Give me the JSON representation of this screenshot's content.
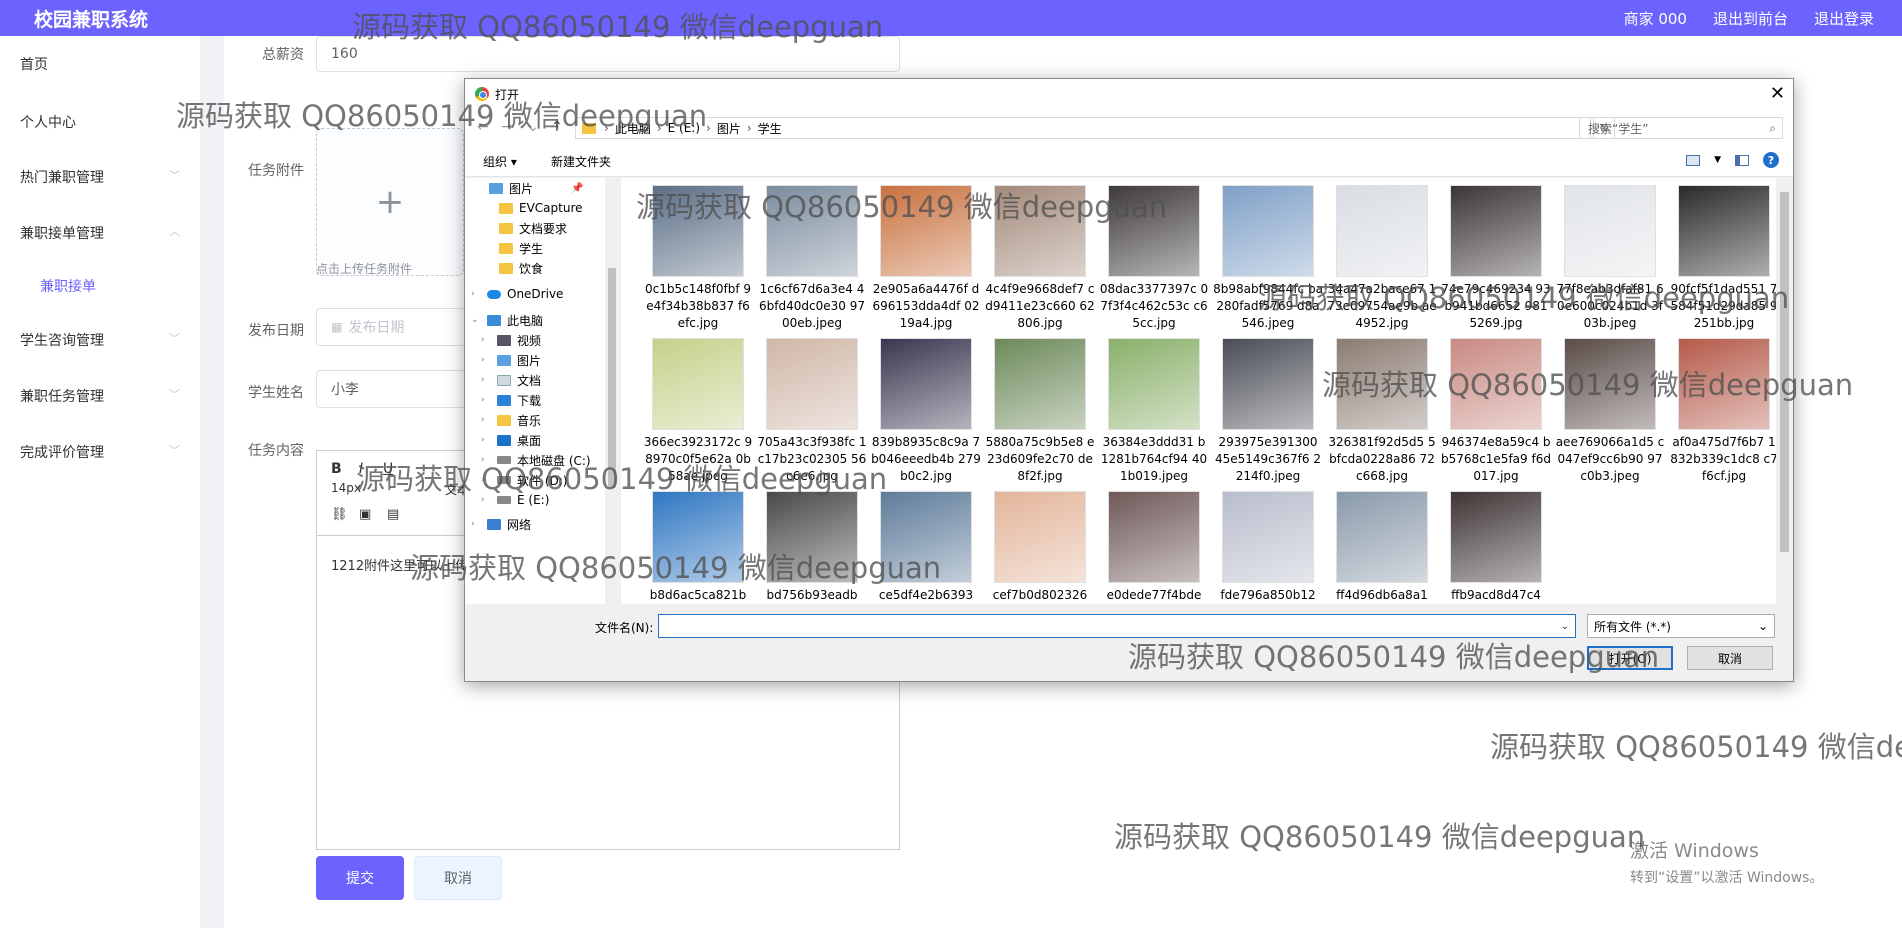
{
  "topbar": {
    "brand": "校园兼职系统",
    "merchant": "商家 000",
    "exit_front": "退出到前台",
    "logout": "退出登录"
  },
  "sidebar": {
    "items": [
      {
        "label": "首页"
      },
      {
        "label": "个人中心"
      },
      {
        "label": "热门兼职管理"
      },
      {
        "label": "兼职接单管理"
      },
      {
        "label": "兼职接单"
      },
      {
        "label": "学生咨询管理"
      },
      {
        "label": "兼职任务管理"
      },
      {
        "label": "完成评价管理"
      }
    ]
  },
  "form": {
    "salary_label": "总薪资",
    "salary_value": "160",
    "attachment_label": "任务附件",
    "upload_plus": "+",
    "upload_hint": "点击上传任务附件",
    "date_label": "发布日期",
    "date_placeholder": "发布日期",
    "student_label": "学生姓名",
    "student_value": "小李",
    "content_label": "任务内容",
    "editor_bold": "B",
    "editor_italic": "I",
    "editor_underline": "U",
    "editor_fontsize": "14px",
    "editor_text_type": "文本",
    "editor_content": "1212附件这里可以上传",
    "submit": "提交",
    "cancel": "取消"
  },
  "windows_activation": {
    "line1": "激活 Windows",
    "line2": "转到“设置”以激活 Windows。"
  },
  "dialog": {
    "title": "打开",
    "close_glyph": "✕",
    "address": [
      "此电脑",
      "E (E:)",
      "图片",
      "学生"
    ],
    "search_placeholder": "搜索“学生”",
    "organize": "组织 ▾",
    "new_folder": "新建文件夹",
    "nav_items": [
      {
        "label": "图片",
        "icon": "picture-folder-icon"
      },
      {
        "label": "EVCapture",
        "icon": "folder-icon"
      },
      {
        "label": "文档要求",
        "icon": "folder-icon"
      },
      {
        "label": "学生",
        "icon": "folder-icon"
      },
      {
        "label": "饮食",
        "icon": "folder-icon"
      },
      {
        "label": "OneDrive",
        "icon": "onedrive-icon"
      },
      {
        "label": "此电脑",
        "icon": "computer-icon"
      },
      {
        "label": "视频",
        "icon": "video-folder-icon"
      },
      {
        "label": "图片",
        "icon": "picture-folder-icon"
      },
      {
        "label": "文档",
        "icon": "document-folder-icon"
      },
      {
        "label": "下载",
        "icon": "download-folder-icon"
      },
      {
        "label": "音乐",
        "icon": "music-folder-icon"
      },
      {
        "label": "桌面",
        "icon": "desktop-folder-icon"
      },
      {
        "label": "本地磁盘 (C:)",
        "icon": "drive-icon"
      },
      {
        "label": "软件 (D:)",
        "icon": "drive-icon"
      },
      {
        "label": "E (E:)",
        "icon": "drive-icon"
      },
      {
        "label": "网络",
        "icon": "network-icon"
      }
    ],
    "files": [
      {
        "name": "0c1b5c148f0fbf 9e4f34b38b837 f6efc.jpg",
        "color": "#5b6f86"
      },
      {
        "name": "1c6cf67d6a3e4 46bfd40dc0e30 9700eb.jpeg",
        "color": "#7b8c9e"
      },
      {
        "name": "2e905a6a4476f d696153dda4df 0219a4.jpg",
        "color": "#c9713e"
      },
      {
        "name": "4c4f9e9668def7 cd9411e23c660 62806.jpg",
        "color": "#a38a7a"
      },
      {
        "name": "08dac3377397c 07f3f4c462c53c c65cc.jpg",
        "color": "#3f3a3a"
      },
      {
        "name": "8b98abf9844fc ba280fadf5769 d8a546.jpeg",
        "color": "#7fa0c7"
      },
      {
        "name": "34a47a2bace67 173e09754ae9b ae4952.jpg",
        "color": "#d9dde3"
      },
      {
        "name": "74e79c469234 93b941bd6652 9815269.jpg",
        "color": "#3c3535"
      },
      {
        "name": "77f8eab3dfaf81 60e600c024b1d 3f03b.jpeg",
        "color": "#e1e4e8"
      },
      {
        "name": "90fcf5f1dad551 7584f51d29da85 9251bb.jpg",
        "color": "#2a2a2a"
      },
      {
        "name": "366ec3923172c 98970c0f5e62a 0b58ae.jpeg",
        "color": "#c7d08a"
      },
      {
        "name": "705a43c3f938fc 1c17b23c02305 56c6e6.jpg",
        "color": "#d0b7a8"
      },
      {
        "name": "839b8935c8c9a 7b046eeedb4b 279b0c2.jpg",
        "color": "#3a3650"
      },
      {
        "name": "5880a75c9b5e8 e23d609fe2c70 de8f2f.jpg",
        "color": "#6d8a5a"
      },
      {
        "name": "36384e3ddd31 b1281b764cf94 401b019.jpeg",
        "color": "#8ab06a"
      },
      {
        "name": "293975e391300 45e5149c367f6 2214f0.jpeg",
        "color": "#4a4d56"
      },
      {
        "name": "326381f92d5d5 5bfcda0228a86 72c668.jpg",
        "color": "#8b7c72"
      },
      {
        "name": "946374e8a59c4 bb5768c1e5fa9 f6d017.jpg",
        "color": "#c98a82"
      },
      {
        "name": "aee769066a1d5 c047ef9cc6b90 97c0b3.jpeg",
        "color": "#5a4c48"
      },
      {
        "name": "af0a475d7f6b7 1832b339c1dc8 c7f6cf.jpg",
        "color": "#b55a4a"
      },
      {
        "name": "b8d6ac5ca821b",
        "color": "#2f77c2"
      },
      {
        "name": "bd756b93eadb",
        "color": "#4a4a4a"
      },
      {
        "name": "ce5df4e2b6393",
        "color": "#5e7c9a"
      },
      {
        "name": "cef7b0d802326",
        "color": "#e3b59a"
      },
      {
        "name": "e0dede77f4bde",
        "color": "#6f5858"
      },
      {
        "name": "fde796a850b12",
        "color": "#b9bdcc"
      },
      {
        "name": "ff4d96db6a8a1",
        "color": "#8a9aaa"
      },
      {
        "name": "ffb9acd8d47c4",
        "color": "#3e3434"
      }
    ],
    "filename_label": "文件名(N):",
    "filename_value": "",
    "filetype": "所有文件 (*.*)",
    "open_button": "打开(O)",
    "cancel_button": "取消"
  },
  "watermark_text": "源码获取 QQ86050149 微信deepguan"
}
